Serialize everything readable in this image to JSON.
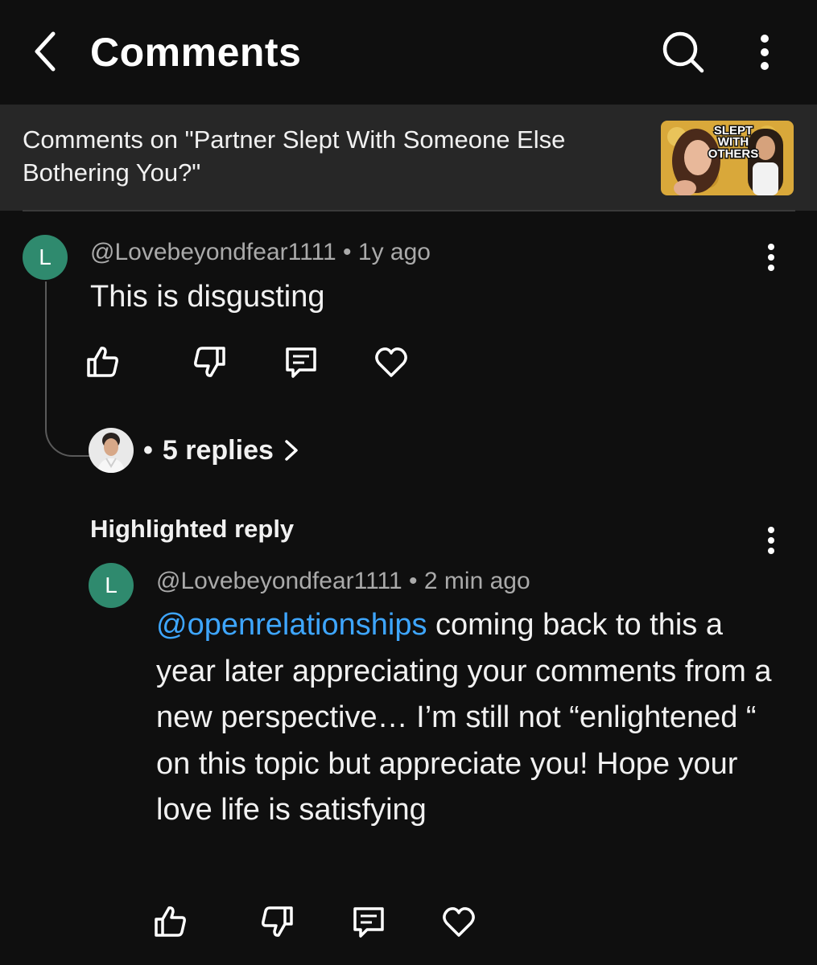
{
  "header": {
    "title": "Comments"
  },
  "video": {
    "title": "Comments on \"Partner Slept With Someone Else Bothering You?\"",
    "thumb_text_1": "SLEPT",
    "thumb_text_2": "WITH",
    "thumb_text_3": "OTHERS"
  },
  "comment": {
    "avatar_letter": "L",
    "author": "@Lovebeyondfear1111",
    "separator": "•",
    "time": "1y ago",
    "text": "This is disgusting",
    "replies_dot": "•",
    "replies_label": "5 replies"
  },
  "highlighted": {
    "label": "Highlighted reply",
    "avatar_letter": "L",
    "author": "@Lovebeyondfear1111",
    "separator": "•",
    "time": "2 min ago",
    "mention": "@openrelationships",
    "text": " coming back to this a year later appreciating your comments from a new perspective… I’m still not “enlightened “ on this topic but appreciate you! Hope your love life is satisfying"
  },
  "colors": {
    "background": "#0f0f0f",
    "video_bar": "#272727",
    "avatar": "#2f8a6e",
    "mention": "#3ea6ff",
    "meta_text": "#aaaaaa"
  },
  "icons": [
    "chevron-left-icon",
    "search-icon",
    "more-vertical-icon",
    "thumbs-up-icon",
    "thumbs-down-icon",
    "reply-icon",
    "heart-icon",
    "chevron-right-icon"
  ]
}
